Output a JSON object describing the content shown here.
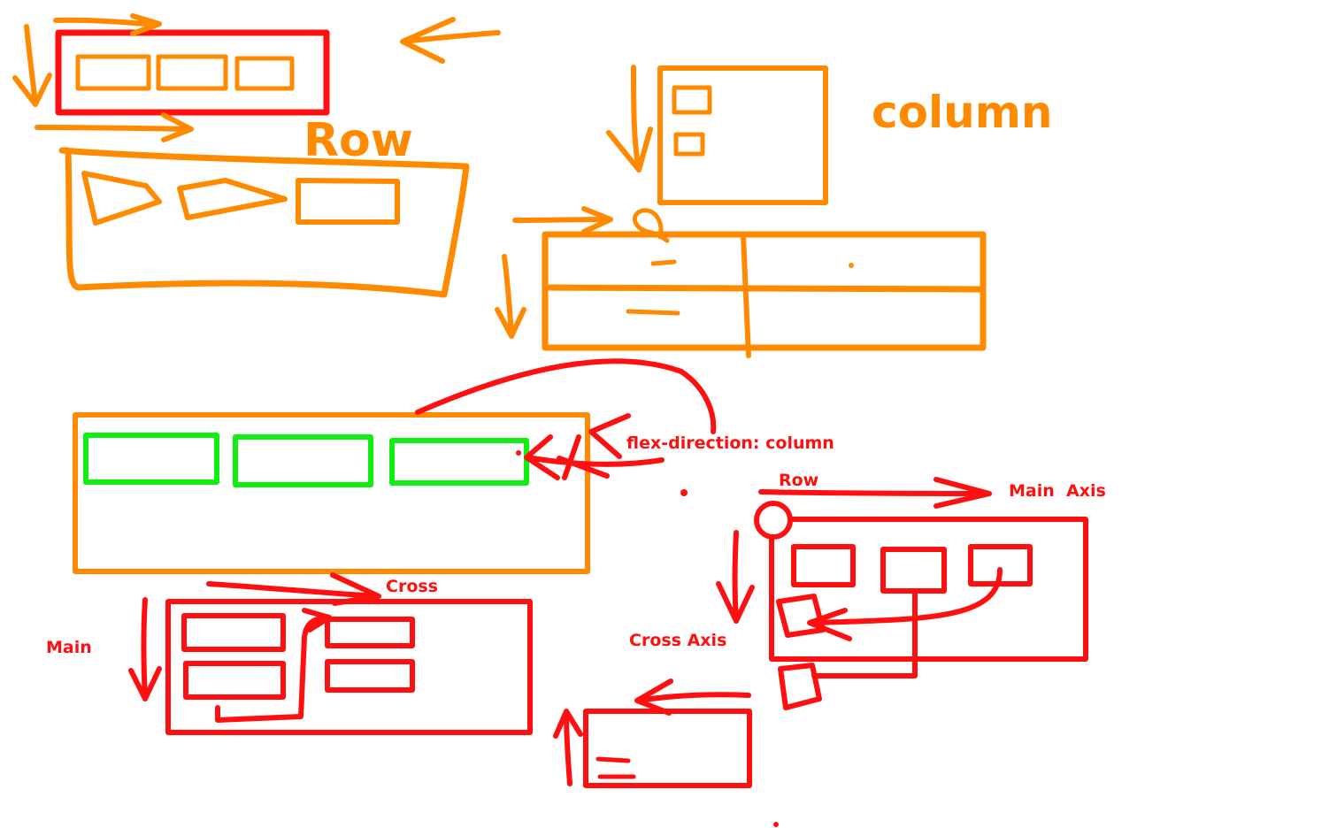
{
  "colors": {
    "orange": "#ff8a00",
    "red": "#ff0f0f",
    "green": "#11ee11",
    "background": "#ffffff"
  },
  "labels": {
    "row_big": "Row",
    "column": "column",
    "flex_direction": "flex-direction: column",
    "row_small": "Row",
    "main_axis": "Main  Axis",
    "cross": "Cross",
    "main": "Main",
    "cross_axis": "Cross Axis"
  }
}
